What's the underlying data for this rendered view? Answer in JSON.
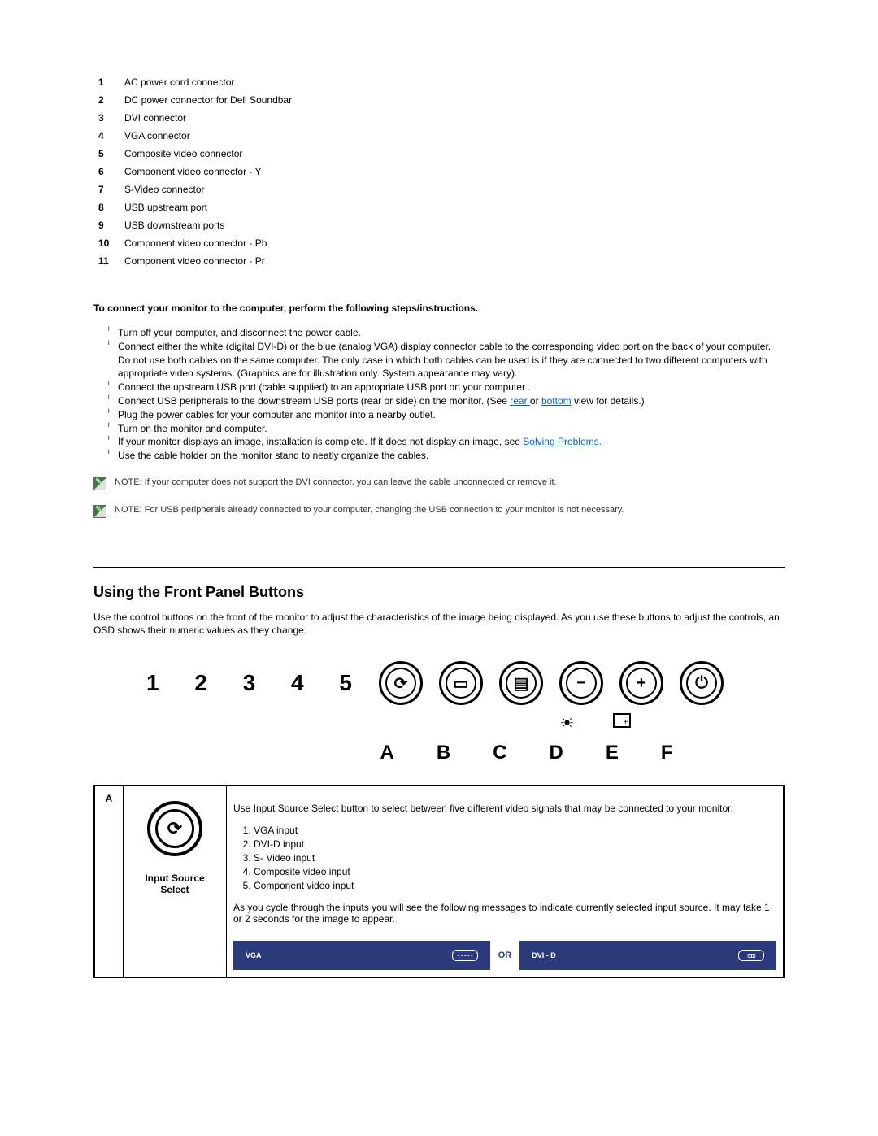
{
  "connectors": [
    {
      "num": "1",
      "label": "AC power cord connector"
    },
    {
      "num": "2",
      "label": "DC power connector for Dell Soundbar"
    },
    {
      "num": "3",
      "label": "DVI connector"
    },
    {
      "num": "4",
      "label": "VGA connector"
    },
    {
      "num": "5",
      "label": "Composite video connector"
    },
    {
      "num": "6",
      "label": "Component video connector - Y"
    },
    {
      "num": "7",
      "label": "S-Video connector"
    },
    {
      "num": "8",
      "label": "USB upstream port"
    },
    {
      "num": "9",
      "label": "USB downstream ports"
    },
    {
      "num": "10",
      "label": "Component video connector - Pb"
    },
    {
      "num": "11",
      "label": "Component video connector - Pr"
    }
  ],
  "connect_heading": "To connect your monitor to the computer, perform the following steps/instructions.",
  "steps": {
    "s1": "Turn off your computer, and disconnect the power cable.",
    "s2a": "Connect either the white (digital DVI-D) or the blue (analog VGA) display connector cable to the corresponding video port on the back of your computer. Do not use both cables on the same computer. The only case in which both cables can be used is if they are connected to two different computers with appropriate video systems. (Graphics are for illustration only. System appearance may vary).",
    "s3": "Connect the upstream USB port (cable supplied) to an appropriate USB port on your computer .",
    "s4a": "Connect USB peripherals to the downstream USB ports (rear or side) on the monitor. (See ",
    "s4_link1": "rear ",
    "s4_mid": "or ",
    "s4_link2": "bottom",
    "s4b": " view for details.)",
    "s5": "Plug the power cables for your computer and monitor into a nearby outlet.",
    "s6": "Turn on the monitor and computer.",
    "s7a": "If your monitor displays an image, installation is complete. If it does not display an image, see ",
    "s7_link": "Solving Problems.",
    "s8": "Use the cable holder on the monitor stand to neatly organize the cables."
  },
  "note1": "NOTE: If your computer does not support the DVI connector, you can leave the cable unconnected or remove it.",
  "note2": "NOTE: For USB peripherals already connected to your computer, changing the USB connection to your monitor is not necessary.",
  "section_heading": "Using the Front Panel Buttons",
  "intro": "Use the control buttons on the front of the monitor to adjust the characteristics of the image being displayed. As you use these buttons to adjust the controls, an OSD shows their numeric values as they change.",
  "diagram": {
    "numbers": "1  2  3  4  5",
    "letters": [
      "A",
      "B",
      "C",
      "D",
      "E",
      "F"
    ]
  },
  "table": {
    "row_a": {
      "letter": "A",
      "icon_label": "Input Source Select",
      "desc_intro": "Use Input Source Select button to select between five different video signals that may be connected to your monitor.",
      "inputs": [
        "VGA input",
        "DVI-D input",
        "S- Video input",
        "Composite video input",
        "Component video input"
      ],
      "desc_outro": "As you cycle through the inputs you will see the following messages to indicate currently selected input source. It may take 1 or 2 seconds for the image to appear.",
      "osd_vga": "VGA",
      "osd_or": "OR",
      "osd_dvi": "DVI - D"
    }
  }
}
